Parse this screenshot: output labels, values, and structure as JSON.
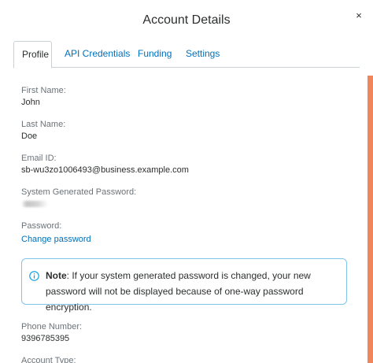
{
  "modal": {
    "title": "Account Details",
    "close_glyph": "×"
  },
  "tabs": [
    {
      "label": "Profile",
      "active": true
    },
    {
      "label": "API Credentials",
      "active": false
    },
    {
      "label": "Funding",
      "active": false
    },
    {
      "label": "Settings",
      "active": false
    }
  ],
  "profile": {
    "first_name": {
      "label": "First Name:",
      "value": "John"
    },
    "last_name": {
      "label": "Last Name:",
      "value": "Doe"
    },
    "email": {
      "label": "Email ID:",
      "value": "sb-wu3zo1006493@business.example.com"
    },
    "generated_password": {
      "label": "System Generated Password:"
    },
    "password": {
      "label": "Password:",
      "link": "Change password"
    },
    "note": {
      "bold": "Note",
      "text": ": If your system generated password is changed, your new password will not be displayed because of one-way password encryption."
    },
    "phone": {
      "label": "Phone Number:",
      "value": "9396785395"
    },
    "account_type": {
      "label": "Account Type:"
    }
  },
  "colors": {
    "link": "#0070ba",
    "info_border": "#7fc4eb",
    "info_icon": "#009cde",
    "accent_strip": "#f0865a"
  }
}
